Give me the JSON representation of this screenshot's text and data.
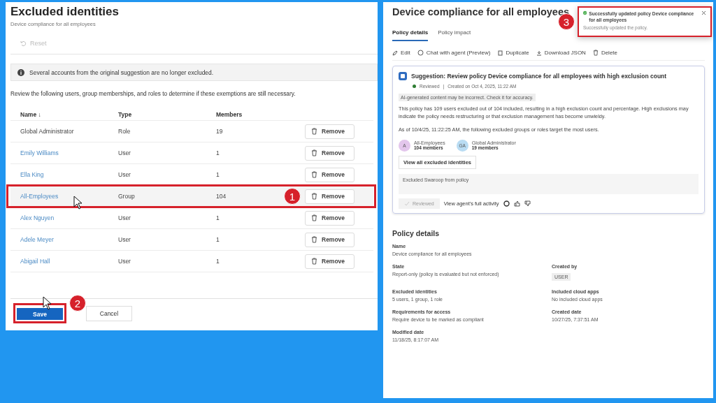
{
  "left_panel": {
    "title": "Excluded identities",
    "subtitle": "Device compliance for all employees",
    "reset_button": {
      "label": "Reset",
      "disabled": true
    },
    "info_message": "Several accounts from the original suggestion are no longer excluded.",
    "instructions": "Review the following users, group memberships, and roles to determine if these exemptions are still necessary.",
    "table": {
      "columns": [
        "Name ↓",
        "Type",
        "Members"
      ],
      "rows": [
        {
          "name": "Global Administrator",
          "linked": false,
          "type": "Role",
          "members": "19",
          "action": "Remove",
          "selected": false
        },
        {
          "name": "Emily Williams",
          "linked": true,
          "type": "User",
          "members": "1",
          "action": "Remove",
          "selected": false
        },
        {
          "name": "Ella King",
          "linked": true,
          "type": "User",
          "members": "1",
          "action": "Remove",
          "selected": false
        },
        {
          "name": "All-Employees",
          "linked": true,
          "type": "Group",
          "members": "104",
          "action": "Remove",
          "selected": true,
          "callout": "1"
        },
        {
          "name": "Alex Nguyen",
          "linked": true,
          "type": "User",
          "members": "1",
          "action": "Remove",
          "selected": false
        },
        {
          "name": "Adele Meyer",
          "linked": true,
          "type": "User",
          "members": "1",
          "action": "Remove",
          "selected": false
        },
        {
          "name": "Abigail Hall",
          "linked": true,
          "type": "User",
          "members": "1",
          "action": "Remove",
          "selected": false
        }
      ]
    },
    "save_button": {
      "label": "Save",
      "callout": "2"
    },
    "cancel_button": {
      "label": "Cancel"
    }
  },
  "right_panel": {
    "title": "Device compliance for all employees",
    "tabs": [
      {
        "label": "Policy details",
        "selected": true
      },
      {
        "label": "Policy impact",
        "selected": false
      }
    ],
    "toolbar": [
      {
        "kind": "edit",
        "label": "Edit"
      },
      {
        "kind": "chat",
        "label": "Chat with agent (Preview)"
      },
      {
        "kind": "duplicate",
        "label": "Duplicate"
      },
      {
        "kind": "download",
        "label": "Download JSON"
      },
      {
        "kind": "delete",
        "label": "Delete"
      }
    ],
    "suggestion": {
      "title": "Suggestion: Review policy Device compliance for all employees with high exclusion count",
      "status": "Reviewed",
      "separator": "|",
      "created": "Created on Oct 4, 2025, 11:22 AM",
      "disclaimer": "AI-generated content may be incorrect. Check it for accuracy.",
      "body": "This policy has 109 users excluded out of 104 included, resulting in a high exclusion count and percentage. High exclusions may indicate the policy needs restructuring or that exclusion management has become unwieldy.",
      "as_of": "As of 10/4/25, 11:22:25 AM, the following excluded groups or roles target the most users.",
      "targets": [
        {
          "initials": "A",
          "name": "All-Employees",
          "members": "104 members",
          "color": "#e3c6ec"
        },
        {
          "initials": "GA",
          "name": "Global Administrator",
          "members": "19 members",
          "color": "#b9dcf3"
        }
      ],
      "view_button": "View all excluded identities",
      "note": "Excluded Swaroop from policy",
      "reviewed_button": {
        "label": "Reviewed",
        "disabled": true
      },
      "activity_link": "View agent's full activity"
    },
    "details": {
      "heading": "Policy details",
      "fields": [
        {
          "label": "Name",
          "value": "Device compliance for all employees",
          "kind": "text"
        },
        {
          "label": "State",
          "value": "Report-only (policy is evaluated but not enforced)",
          "kind": "text"
        },
        {
          "label": "Created by",
          "value": "USER",
          "kind": "tag"
        },
        {
          "label": "Excluded identities",
          "value": "5 users, 1 group, 1 role",
          "kind": "text"
        },
        {
          "label": "Included cloud apps",
          "value": "No included cloud apps",
          "kind": "text"
        },
        {
          "label": "Requirements for access",
          "value": "Require device to be marked as compliant",
          "kind": "text"
        },
        {
          "label": "Created date",
          "value": "10/27/25, 7:37:51 AM",
          "kind": "text"
        },
        {
          "label": "Modified date",
          "value": "11/18/25, 8:17:07 AM",
          "kind": "text"
        }
      ]
    },
    "toast": {
      "title": "Successfully updated policy Device compliance for all employees",
      "message": "Successfully updated the policy.",
      "callout": "3"
    }
  }
}
